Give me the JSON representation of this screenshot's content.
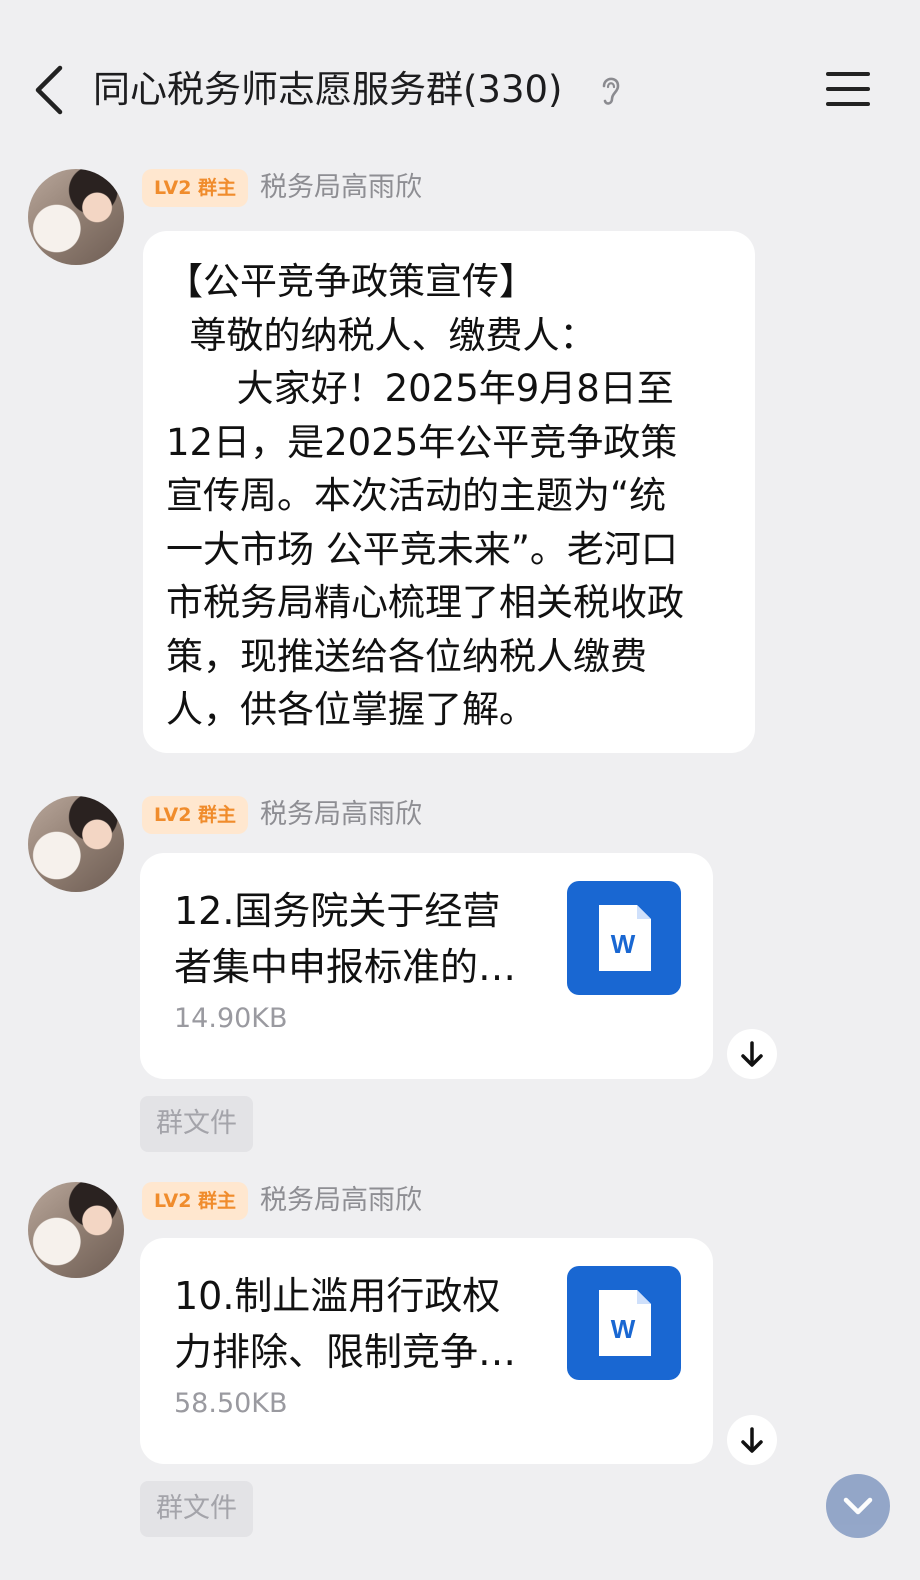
{
  "header": {
    "title": "同心税务师志愿服务群(330)"
  },
  "messages": [
    {
      "badge": "LV2 群主",
      "sender": "税务局高雨欣",
      "type": "text",
      "lines": [
        "【公平竞争政策宣传】",
        "  尊敬的纳税人、缴费人：",
        "      大家好！2025年9月8日至",
        "12日，是2025年公平竞争政策",
        "宣传周。本次活动的主题为“统",
        "一大市场 公平竞未来”。老河口",
        "市税务局精心梳理了相关税收政",
        "策，现推送给各位纳税人缴费",
        "人，供各位掌握了解。"
      ]
    },
    {
      "badge": "LV2 群主",
      "sender": "税务局高雨欣",
      "type": "file",
      "file_name_lines": [
        "12.国务院关于经营",
        "者集中申报标准的…"
      ],
      "file_size": "14.90KB",
      "file_icon": "word-doc-icon",
      "tag": "群文件"
    },
    {
      "badge": "LV2 群主",
      "sender": "税务局高雨欣",
      "type": "file",
      "file_name_lines": [
        "10.制止滥用行政权",
        "力排除、限制竞争…"
      ],
      "file_size": "58.50KB",
      "file_icon": "word-doc-icon",
      "tag": "群文件"
    }
  ],
  "colors": {
    "background": "#efeff1",
    "badge_bg": "#ffe7cf",
    "badge_text": "#f08c2c",
    "word_blue": "#1967d2"
  }
}
